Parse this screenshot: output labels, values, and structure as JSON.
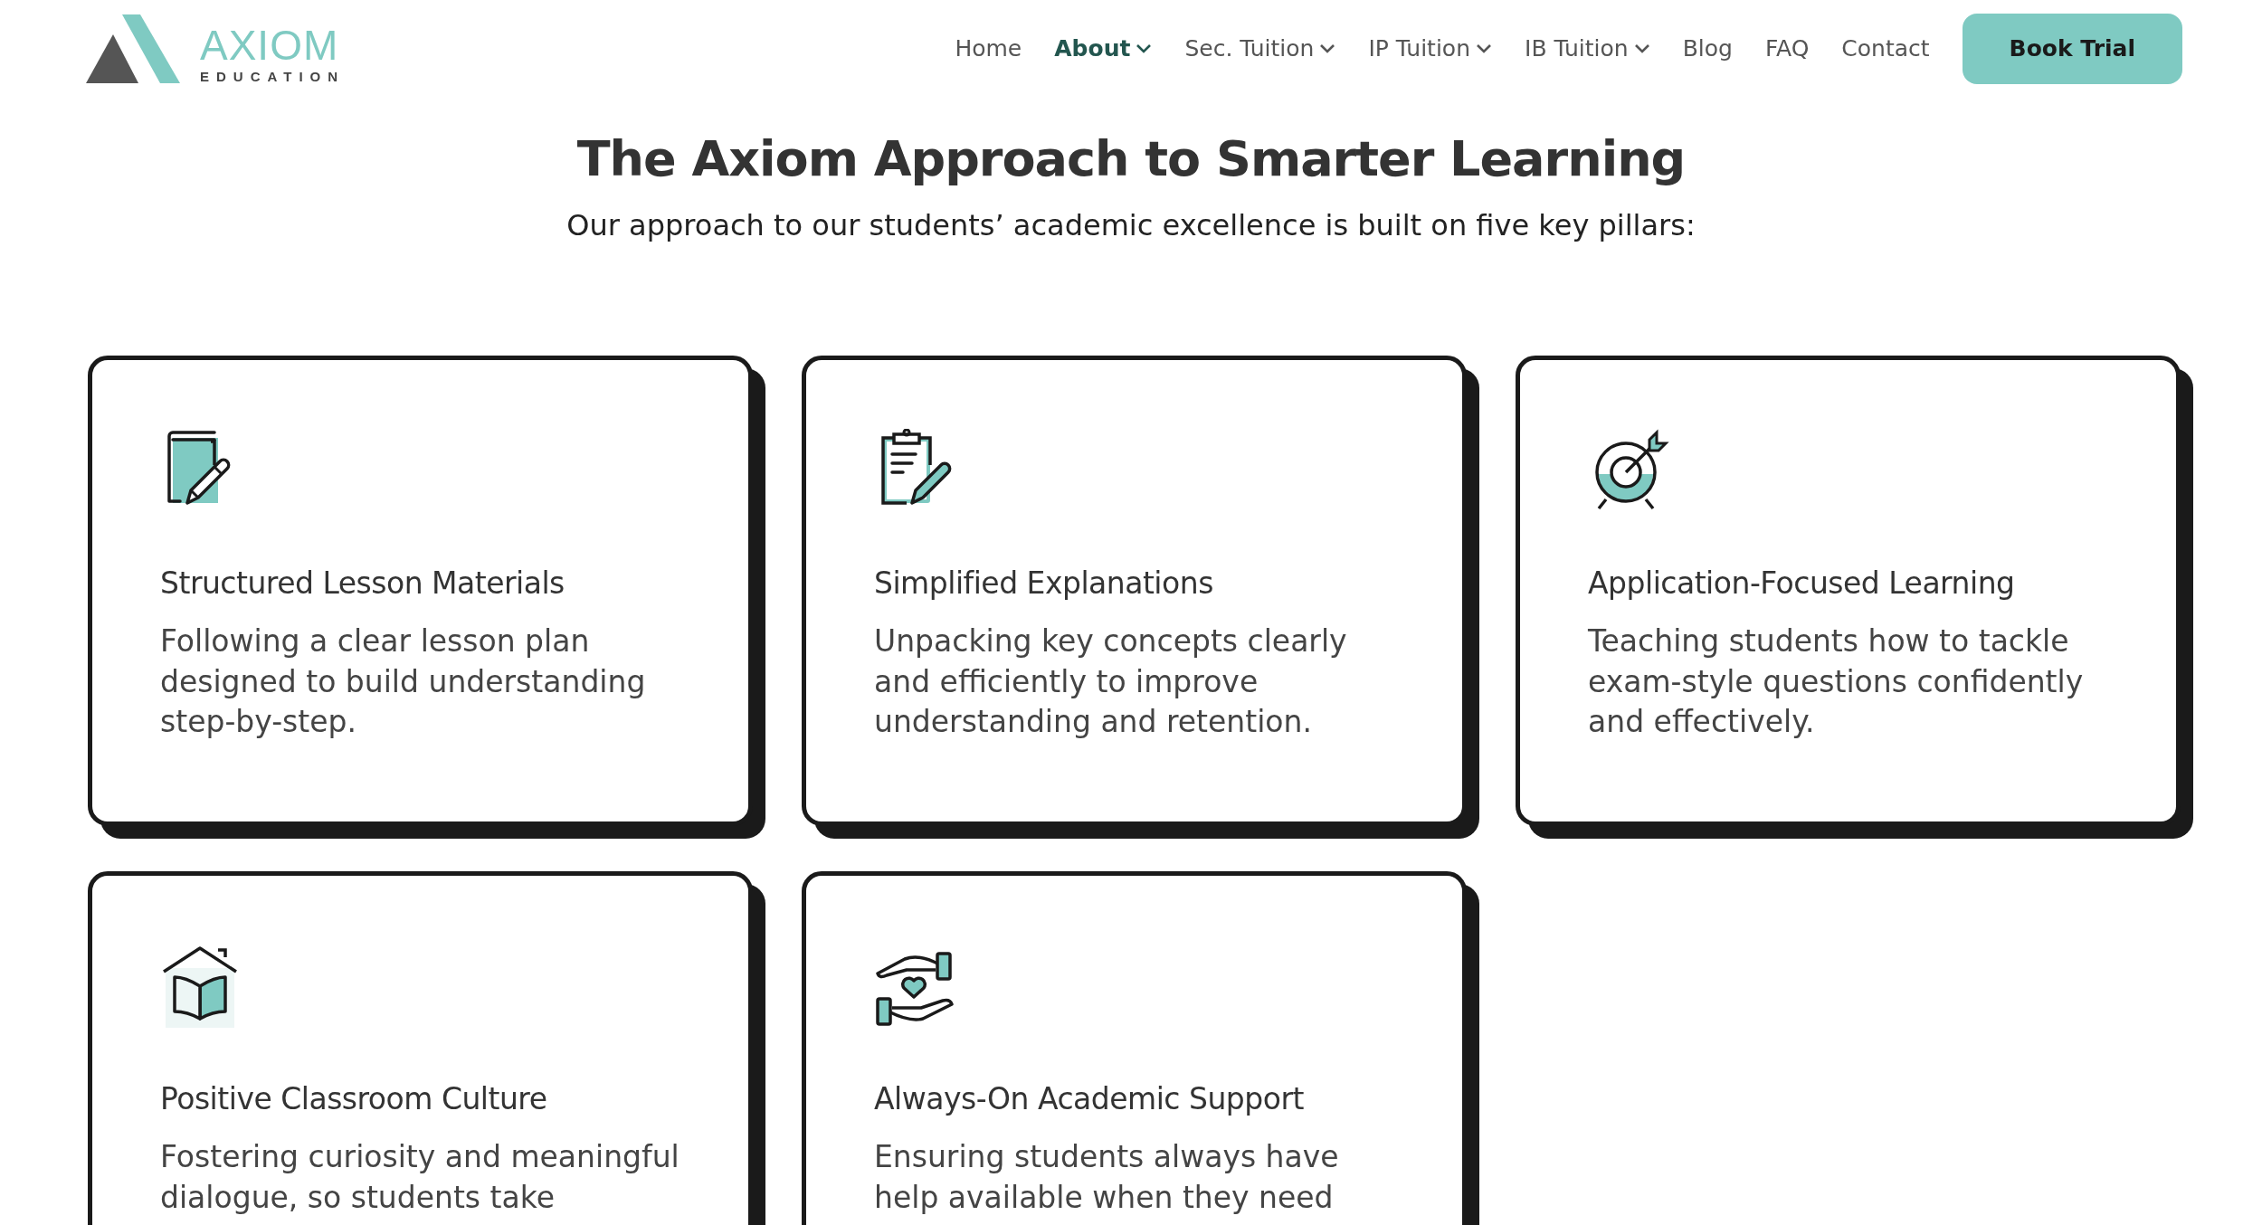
{
  "logo": {
    "wordmark": "AXIOM",
    "tagline": "EDUCATION"
  },
  "nav": [
    {
      "label": "Home",
      "selected": false,
      "dropdown": false
    },
    {
      "label": "About",
      "selected": true,
      "dropdown": true
    },
    {
      "label": "Sec. Tuition",
      "selected": false,
      "dropdown": true
    },
    {
      "label": "IP Tuition",
      "selected": false,
      "dropdown": true
    },
    {
      "label": "IB Tuition",
      "selected": false,
      "dropdown": true
    },
    {
      "label": "Blog",
      "selected": false,
      "dropdown": false
    },
    {
      "label": "FAQ",
      "selected": false,
      "dropdown": false
    },
    {
      "label": "Contact",
      "selected": false,
      "dropdown": false
    }
  ],
  "cta": "Book Trial",
  "heading": "The Axiom Approach to Smarter Learning",
  "subheading": "Our approach to our students’ academic excellence is built on five key pillars:",
  "pillars": [
    {
      "title": "Structured Lesson Materials",
      "text": "Following a clear lesson plan designed to build understanding step-by-step."
    },
    {
      "title": "Simplified Explanations",
      "text": "Unpacking key concepts clearly and efficiently to improve understanding and retention."
    },
    {
      "title": "Application-Focused Learning",
      "text": "Teaching students how to tackle exam-style questions confidently and effectively."
    },
    {
      "title": "Positive Classroom Culture",
      "text": "Fostering curiosity and meaningful dialogue, so students take"
    },
    {
      "title": "Always-On Academic Support",
      "text": "Ensuring students always have help available when they need"
    }
  ]
}
